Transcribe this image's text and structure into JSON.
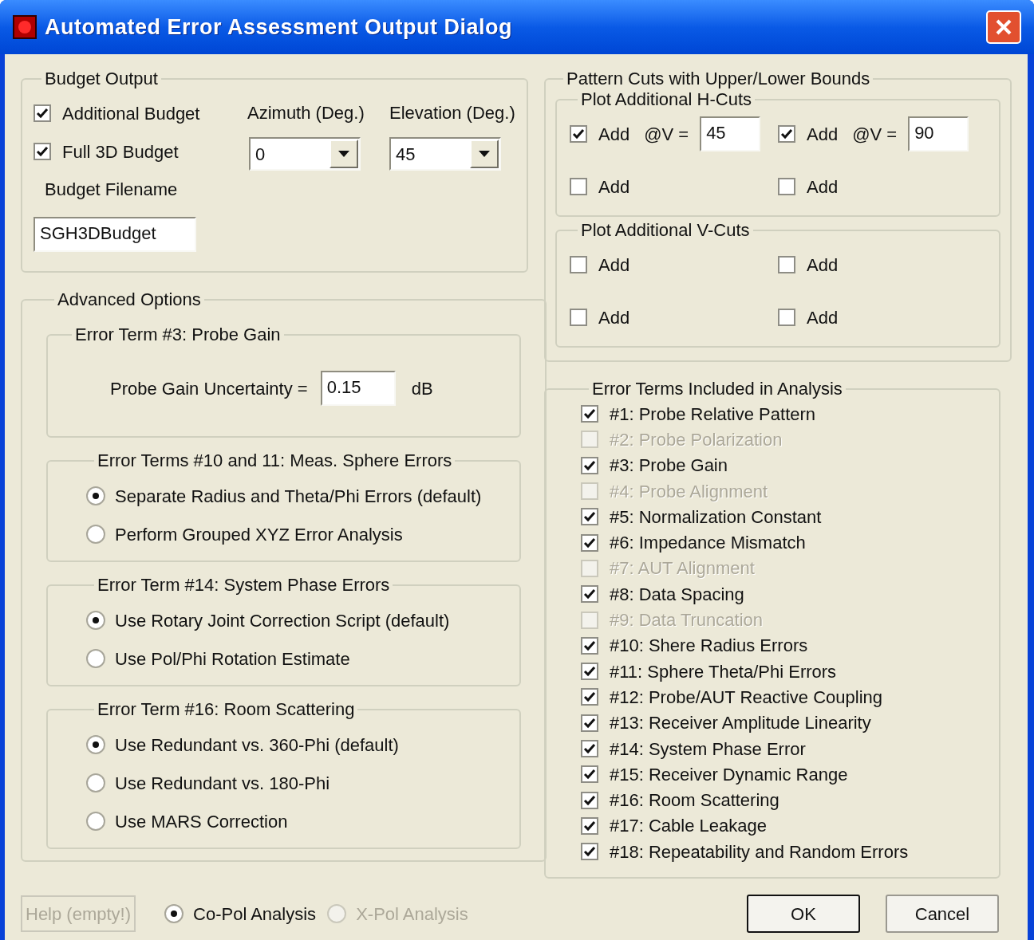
{
  "window": {
    "title": "Automated Error Assessment Output Dialog"
  },
  "budget_output": {
    "title": "Budget Output",
    "checkboxes": [
      {
        "label": "Additional Budget",
        "checked": true
      },
      {
        "label": "Full 3D Budget",
        "checked": true
      }
    ],
    "azimuth": {
      "label": "Azimuth (Deg.)",
      "value": "0"
    },
    "elevation": {
      "label": "Elevation (Deg.)",
      "value": "45"
    },
    "filename": {
      "label": "Budget Filename",
      "value": "SGH3DBudget"
    }
  },
  "advanced_options": {
    "title": "Advanced Options",
    "probe_gain": {
      "title": "Error Term #3: Probe Gain",
      "label": "Probe Gain Uncertainty =",
      "value": "0.15",
      "unit": "dB"
    },
    "radio_groups": [
      {
        "title": "Error Terms #10 and 11: Meas. Sphere Errors",
        "options": [
          {
            "label": "Separate Radius and Theta/Phi Errors (default)",
            "selected": true
          },
          {
            "label": "Perform Grouped XYZ Error Analysis",
            "selected": false
          }
        ]
      },
      {
        "title": "Error Term #14: System Phase Errors",
        "options": [
          {
            "label": "Use Rotary Joint Correction Script (default)",
            "selected": true
          },
          {
            "label": "Use Pol/Phi Rotation Estimate",
            "selected": false
          }
        ]
      },
      {
        "title": "Error Term #16: Room Scattering",
        "options": [
          {
            "label": "Use Redundant vs. 360-Phi (default)",
            "selected": true
          },
          {
            "label": "Use Redundant vs. 180-Phi",
            "selected": false
          },
          {
            "label": "Use MARS Correction",
            "selected": false
          }
        ]
      }
    ]
  },
  "pattern_cuts": {
    "title": "Pattern Cuts with Upper/Lower Bounds",
    "groups": [
      {
        "title": "Plot Additional H-Cuts",
        "items": [
          {
            "label": "Add",
            "checked": true,
            "at_label": "@V =",
            "value": "45"
          },
          {
            "label": "Add",
            "checked": true,
            "at_label": "@V =",
            "value": "90"
          },
          {
            "label": "Add",
            "checked": false
          },
          {
            "label": "Add",
            "checked": false
          }
        ]
      },
      {
        "title": "Plot Additional V-Cuts",
        "items": [
          {
            "label": "Add",
            "checked": false
          },
          {
            "label": "Add",
            "checked": false
          },
          {
            "label": "Add",
            "checked": false
          },
          {
            "label": "Add",
            "checked": false
          }
        ]
      }
    ]
  },
  "error_terms": {
    "title": "Error Terms Included in Analysis",
    "items": [
      {
        "label": "#1: Probe Relative Pattern",
        "checked": true,
        "disabled": false
      },
      {
        "label": "#2: Probe Polarization",
        "checked": false,
        "disabled": true
      },
      {
        "label": "#3: Probe Gain",
        "checked": true,
        "disabled": false
      },
      {
        "label": "#4: Probe Alignment",
        "checked": false,
        "disabled": true
      },
      {
        "label": "#5: Normalization Constant",
        "checked": true,
        "disabled": false
      },
      {
        "label": "#6: Impedance Mismatch",
        "checked": true,
        "disabled": false
      },
      {
        "label": "#7: AUT Alignment",
        "checked": false,
        "disabled": true
      },
      {
        "label": "#8: Data Spacing",
        "checked": true,
        "disabled": false
      },
      {
        "label": "#9: Data Truncation",
        "checked": false,
        "disabled": true
      },
      {
        "label": "#10: Shere Radius Errors",
        "checked": true,
        "disabled": false
      },
      {
        "label": "#11: Sphere Theta/Phi Errors",
        "checked": true,
        "disabled": false
      },
      {
        "label": "#12: Probe/AUT Reactive Coupling",
        "checked": true,
        "disabled": false
      },
      {
        "label": "#13: Receiver Amplitude Linearity",
        "checked": true,
        "disabled": false
      },
      {
        "label": "#14: System Phase Error",
        "checked": true,
        "disabled": false
      },
      {
        "label": "#15: Receiver Dynamic Range",
        "checked": true,
        "disabled": false
      },
      {
        "label": "#16: Room Scattering",
        "checked": true,
        "disabled": false
      },
      {
        "label": "#17: Cable Leakage",
        "checked": true,
        "disabled": false
      },
      {
        "label": "#18: Repeatability and Random Errors",
        "checked": true,
        "disabled": false
      }
    ]
  },
  "footer": {
    "help_button": {
      "label": "Help (empty!)",
      "disabled": true
    },
    "analysis": [
      {
        "label": "Co-Pol Analysis",
        "selected": true,
        "disabled": false
      },
      {
        "label": "X-Pol Analysis",
        "selected": false,
        "disabled": true
      }
    ],
    "buttons": [
      "OK",
      "Cancel"
    ]
  }
}
